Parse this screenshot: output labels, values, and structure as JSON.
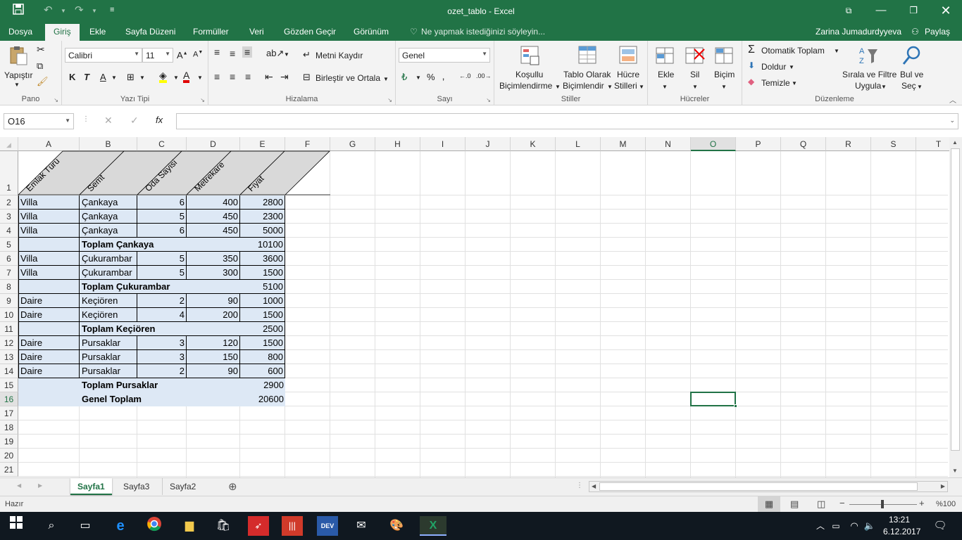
{
  "window": {
    "title": "ozet_tablo - Excel"
  },
  "quick_access": {
    "save": "save-icon",
    "undo": "undo-icon",
    "redo": "redo-icon",
    "customize": "customize-icon"
  },
  "tabs": [
    "Dosya",
    "Giriş",
    "Ekle",
    "Sayfa Düzeni",
    "Formüller",
    "Veri",
    "Gözden Geçir",
    "Görünüm"
  ],
  "active_tab": "Giriş",
  "tell_me": "Ne yapmak istediğinizi söyleyin...",
  "user": {
    "name": "Zarina Jumadurdyyeva",
    "share": "Paylaş"
  },
  "ribbon": {
    "pano": {
      "label": "Pano",
      "paste": "Yapıştır"
    },
    "font": {
      "label": "Yazı Tipi",
      "name": "Calibri",
      "size": "11",
      "bold": "K",
      "italic": "T",
      "underline": "A",
      "font_color": "A"
    },
    "align": {
      "label": "Hizalama",
      "wrap": "Metni Kaydır",
      "merge": "Birleştir ve Ortala"
    },
    "number": {
      "label": "Sayı",
      "format": "Genel",
      "percent": "%",
      "comma": "‚"
    },
    "styles": {
      "label": "Stiller",
      "cond_1": "Koşullu",
      "cond_2": "Biçimlendirme",
      "table_1": "Tablo Olarak",
      "table_2": "Biçimlendir",
      "cell_1": "Hücre",
      "cell_2": "Stilleri"
    },
    "cells": {
      "label": "Hücreler",
      "insert": "Ekle",
      "delete": "Sil",
      "format": "Biçim"
    },
    "edit": {
      "label": "Düzenleme",
      "autosum": "Otomatik Toplam",
      "fill": "Doldur",
      "clear": "Temizle",
      "sort_1": "Sırala ve Filtre",
      "sort_2": "Uygula",
      "find_1": "Bul ve",
      "find_2": "Seç"
    }
  },
  "formula_bar": {
    "name_box": "O16",
    "fx": "fx",
    "formula": ""
  },
  "columns": [
    "A",
    "B",
    "C",
    "D",
    "E",
    "F",
    "G",
    "H",
    "I",
    "J",
    "K",
    "L",
    "M",
    "N",
    "O",
    "P",
    "Q",
    "R",
    "S",
    "T"
  ],
  "selected_col": "O",
  "rows": [
    "1",
    "2",
    "3",
    "4",
    "5",
    "6",
    "7",
    "8",
    "9",
    "10",
    "11",
    "12",
    "13",
    "14",
    "15",
    "16",
    "17",
    "18",
    "19",
    "20",
    "21"
  ],
  "selected_row": "16",
  "headers": [
    "Emlak Türü",
    "Semt",
    "Oda Sayisi",
    "Metrekare",
    "Fiyat"
  ],
  "table_rows": [
    {
      "a": "Villa",
      "b": "Çankaya",
      "c": "6",
      "d": "400",
      "e": "2800",
      "type": "data"
    },
    {
      "a": "Villa",
      "b": "Çankaya",
      "c": "5",
      "d": "450",
      "e": "2300",
      "type": "data"
    },
    {
      "a": "Villa",
      "b": "Çankaya",
      "c": "6",
      "d": "450",
      "e": "5000",
      "type": "data"
    },
    {
      "a": "",
      "b": "Toplam Çankaya",
      "c": "",
      "d": "",
      "e": "10100",
      "type": "sub"
    },
    {
      "a": "Villa",
      "b": "Çukurambar",
      "c": "5",
      "d": "350",
      "e": "3600",
      "type": "data"
    },
    {
      "a": "Villa",
      "b": "Çukurambar",
      "c": "5",
      "d": "300",
      "e": "1500",
      "type": "data"
    },
    {
      "a": "",
      "b": "Toplam Çukurambar",
      "c": "",
      "d": "",
      "e": "5100",
      "type": "sub"
    },
    {
      "a": "Daire",
      "b": "Keçiören",
      "c": "2",
      "d": "90",
      "e": "1000",
      "type": "data"
    },
    {
      "a": "Daire",
      "b": "Keçiören",
      "c": "4",
      "d": "200",
      "e": "1500",
      "type": "data"
    },
    {
      "a": "",
      "b": "Toplam Keçiören",
      "c": "",
      "d": "",
      "e": "2500",
      "type": "sub"
    },
    {
      "a": "Daire",
      "b": "Pursaklar",
      "c": "3",
      "d": "120",
      "e": "1500",
      "type": "data"
    },
    {
      "a": "Daire",
      "b": "Pursaklar",
      "c": "3",
      "d": "150",
      "e": "800",
      "type": "data"
    },
    {
      "a": "Daire",
      "b": "Pursaklar",
      "c": "2",
      "d": "90",
      "e": "600",
      "type": "data"
    },
    {
      "a": "",
      "b": "Toplam Pursaklar",
      "c": "",
      "d": "",
      "e": "2900",
      "type": "total"
    },
    {
      "a": "",
      "b": "Genel Toplam",
      "c": "",
      "d": "",
      "e": "20600",
      "type": "total"
    }
  ],
  "sheets": [
    "Sayfa1",
    "Sayfa3",
    "Sayfa2"
  ],
  "active_sheet": "Sayfa1",
  "status": {
    "ready": "Hazır",
    "zoom": "%100"
  },
  "taskbar": {
    "time": "13:21",
    "date": "6.12.2017"
  },
  "colors": {
    "excel_green": "#217346",
    "table_fill": "#dde8f5",
    "header_fill": "#d9d9d9"
  }
}
